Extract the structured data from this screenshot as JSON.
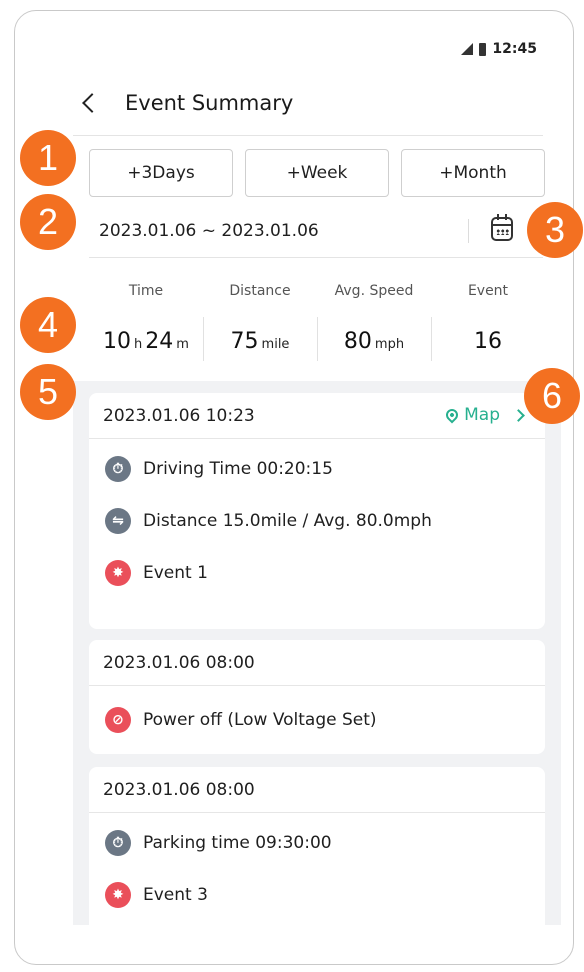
{
  "status": {
    "time": "12:45"
  },
  "header": {
    "title": "Event Summary"
  },
  "periods": [
    "+3Days",
    "+Week",
    "+Month"
  ],
  "date_range": "2023.01.06 ~ 2023.01.06",
  "stats": {
    "time_label": "Time",
    "time_h": "10",
    "time_h_unit": "h",
    "time_m": "24",
    "time_m_unit": "m",
    "distance_label": "Distance",
    "distance_value": "75",
    "distance_unit": "mile",
    "speed_label": "Avg. Speed",
    "speed_value": "80",
    "speed_unit": "mph",
    "event_label": "Event",
    "event_value": "16"
  },
  "cards": [
    {
      "datetime": "2023.01.06 10:23",
      "map_label": "Map",
      "rows": [
        "Driving Time  00:20:15",
        "Distance 15.0mile / Avg. 80.0mph",
        "Event  1"
      ]
    },
    {
      "datetime": "2023.01.06 08:00",
      "rows": [
        "Power off (Low Voltage Set)"
      ]
    },
    {
      "datetime": "2023.01.06 08:00",
      "rows": [
        "Parking time  09:30:00",
        "Event  3"
      ]
    }
  ],
  "icons": {
    "timer": "stopwatch-icon",
    "route": "route-icon",
    "event": "car-event-icon",
    "power": "battery-off-icon",
    "calendar": "calendar-icon",
    "map": "map-pin-icon"
  },
  "colors": {
    "accent_green": "#27b08f",
    "event_red": "#ea4f5a",
    "icon_grey": "#6b7785",
    "callout_orange": "#f37021"
  },
  "callouts": [
    "1",
    "2",
    "3",
    "4",
    "5",
    "6"
  ]
}
